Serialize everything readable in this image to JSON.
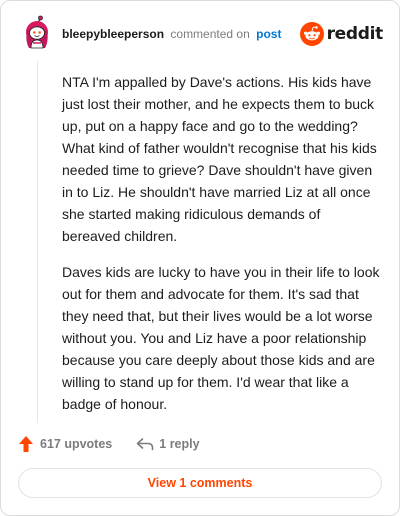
{
  "header": {
    "username": "bleepybleeperson",
    "action_text": "commented on",
    "post_link": "post",
    "brand": "reddit",
    "avatar_icon": "snoo-avatar-icon",
    "logo_icon": "reddit-snoo-icon"
  },
  "comment": {
    "paragraphs": [
      "NTA I'm appalled by Dave's actions. His kids have just lost their mother, and he expects them to buck up, put on a happy face and go to the wedding? What kind of father wouldn't recognise that his kids needed time to grieve? Dave shouldn't have given in to Liz. He shouldn't have married Liz at all once she started making ridiculous demands of bereaved children.",
      "Daves kids are lucky to have you in their life to look out for them and advocate for them. It's sad that they need that, but their lives would be a lot worse without you. You and Liz have a poor relationship because you care deeply about those kids and are willing to stand up for them. I'd wear that like a badge of honour."
    ]
  },
  "actions": {
    "upvotes": "617 upvotes",
    "replies": "1 reply",
    "upvote_icon": "upvote-arrow-icon",
    "reply_icon": "reply-arrow-icon"
  },
  "footer": {
    "view_comments": "View 1 comments"
  },
  "colors": {
    "accent": "#ff4500",
    "link": "#0079d3",
    "muted": "#7c7c7c",
    "avatar": "#d81b60"
  }
}
